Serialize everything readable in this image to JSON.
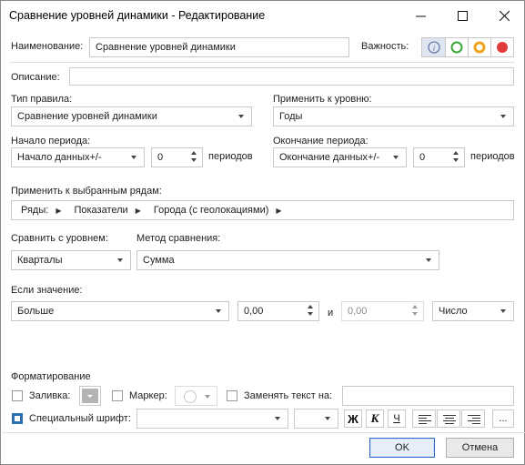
{
  "window": {
    "title": "Сравнение уровней динамики - Редактирование"
  },
  "name": {
    "label": "Наименование:",
    "value": "Сравнение уровней динамики"
  },
  "importance": {
    "label": "Важность:",
    "colors": {
      "info": "#6a7aa8",
      "low": "#3aa636",
      "medium": "#f0a11e",
      "high": "#e03b3b"
    }
  },
  "description": {
    "label": "Описание:",
    "value": ""
  },
  "rule_type": {
    "label": "Тип правила:",
    "value": "Сравнение уровней динамики"
  },
  "apply_level": {
    "label": "Применить к уровню:",
    "value": "Годы"
  },
  "period_start": {
    "label": "Начало периода:",
    "value": "Начало данных+/-",
    "count": "0",
    "unit": "периодов"
  },
  "period_end": {
    "label": "Окончание периода:",
    "value": "Окончание данных+/-",
    "count": "0",
    "unit": "периодов"
  },
  "apply_rows": {
    "label": "Применить к выбранным рядам:",
    "crumbs": [
      "Ряды:",
      "Показатели",
      "Города (с геолокациями)"
    ]
  },
  "compare": {
    "label": "Сравнить с уровнем:",
    "value": "Кварталы"
  },
  "method": {
    "label": "Метод сравнения:",
    "value": "Сумма"
  },
  "condition": {
    "label": "Если значение:",
    "operator": "Больше",
    "value1": "0,00",
    "and": "и",
    "value2": "0,00",
    "kind": "Число"
  },
  "formatting": {
    "label": "Форматирование",
    "fill_label": "Заливка:",
    "marker_label": "Маркер:",
    "replace_label": "Заменять текст на:",
    "replace_value": "",
    "font_label": "Специальный шрифт:",
    "bold": "Ж",
    "italic": "К",
    "underline": "Ч",
    "more": "..."
  },
  "buttons": {
    "ok": "OK",
    "cancel": "Отмена"
  }
}
